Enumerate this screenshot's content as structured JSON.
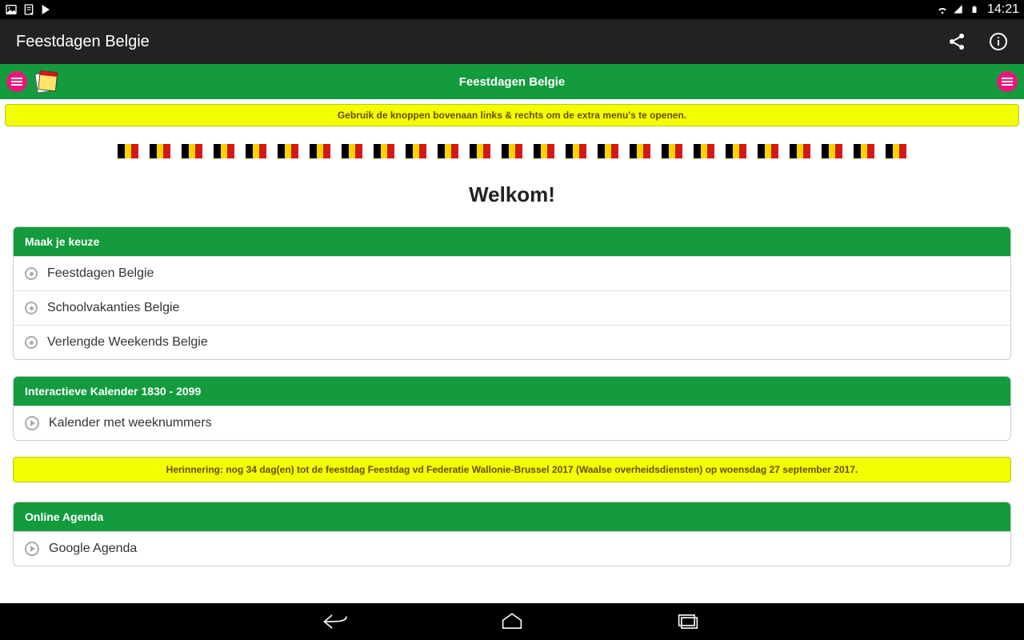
{
  "status": {
    "clock": "14:21"
  },
  "actionbar": {
    "title": "Feestdagen Belgie"
  },
  "header": {
    "title": "Feestdagen Belgie"
  },
  "hint": {
    "text": "Gebruik de knoppen bovenaan links & rechts om de extra menu's te openen."
  },
  "welcome": "Welkom!",
  "section1": {
    "header": "Maak je keuze",
    "items": [
      "Feestdagen Belgie",
      "Schoolvakanties Belgie",
      "Verlengde Weekends Belgie"
    ]
  },
  "section2": {
    "header": "Interactieve Kalender 1830 - 2099",
    "items": [
      "Kalender met weeknummers"
    ]
  },
  "reminder": {
    "text": "Herinnering: nog 34 dag(en) tot de feestdag Feestdag vd Federatie Wallonie-Brussel 2017 (Waalse overheidsdiensten) op woensdag 27 september 2017."
  },
  "section3": {
    "header": "Online Agenda",
    "items": [
      "Google Agenda"
    ]
  },
  "flag_count": 25
}
